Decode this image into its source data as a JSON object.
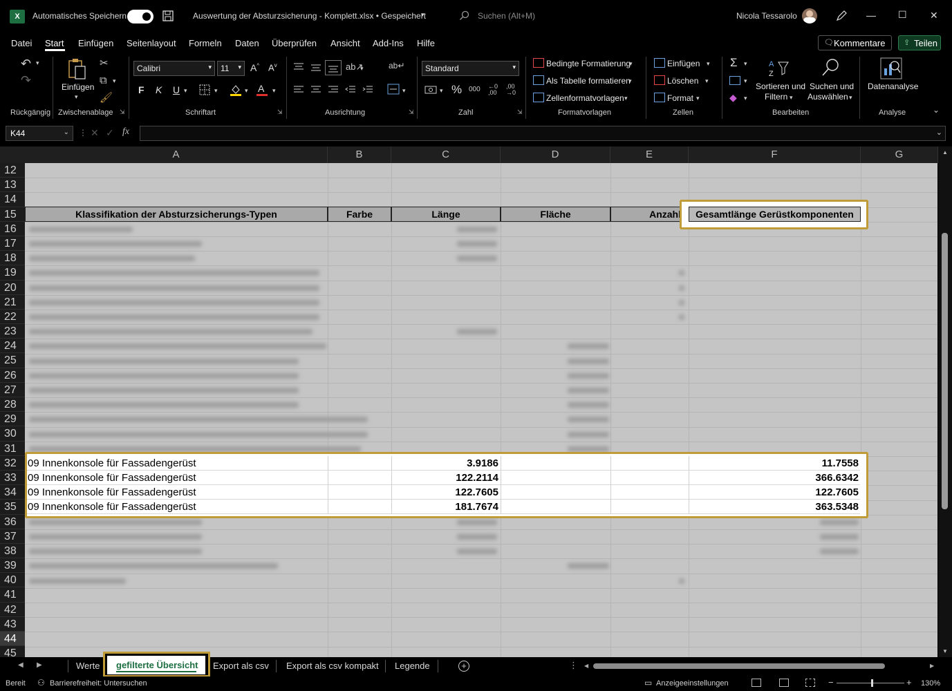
{
  "titlebar": {
    "app_badge": "X",
    "autosave_label": "Automatisches Speichern",
    "document_title": "Auswertung der Absturzsicherung - Komplett.xlsx • Gespeichert",
    "search_placeholder": "Suchen (Alt+M)",
    "user_name": "Nicola Tessarolo",
    "minimize": "—",
    "maximize": "☐",
    "close": "✕"
  },
  "menu": {
    "tabs": [
      "Datei",
      "Start",
      "Einfügen",
      "Seitenlayout",
      "Formeln",
      "Daten",
      "Überprüfen",
      "Ansicht",
      "Add-Ins",
      "Hilfe"
    ],
    "comments_label": "Kommentare",
    "share_label": "Teilen"
  },
  "ribbon": {
    "undo_group": "Rückgängig",
    "clipboard": {
      "paste_label": "Einfügen",
      "group": "Zwischenablage"
    },
    "font": {
      "name": "Calibri",
      "size": "11",
      "bold": "F",
      "italic": "K",
      "underline": "U",
      "group": "Schriftart"
    },
    "alignment": {
      "group": "Ausrichtung"
    },
    "number": {
      "format": "Standard",
      "percent": "%",
      "thousands": "000",
      "group": "Zahl"
    },
    "styles": {
      "conditional": "Bedingte Formatierung",
      "as_table": "Als Tabelle formatieren",
      "cell_styles": "Zellenformatvorlagen",
      "group": "Formatvorlagen"
    },
    "cells": {
      "insert": "Einfügen",
      "delete": "Löschen",
      "format": "Format",
      "group": "Zellen"
    },
    "editing": {
      "sort_filter_1": "Sortieren und",
      "sort_filter_2": "Filtern",
      "find_select_1": "Suchen und",
      "find_select_2": "Auswählen",
      "group": "Bearbeiten"
    },
    "analysis": {
      "label": "Datenanalyse",
      "group": "Analyse"
    }
  },
  "formula_bar": {
    "name_box": "K44",
    "fx": "fx",
    "value": ""
  },
  "columns": [
    "A",
    "B",
    "C",
    "D",
    "E",
    "F",
    "G"
  ],
  "row_numbers": [
    "12",
    "13",
    "14",
    "15",
    "16",
    "17",
    "18",
    "19",
    "20",
    "21",
    "22",
    "23",
    "24",
    "25",
    "26",
    "27",
    "28",
    "29",
    "30",
    "31",
    "32",
    "33",
    "34",
    "35",
    "36",
    "37",
    "38",
    "39",
    "40",
    "41",
    "42",
    "43",
    "44",
    "45"
  ],
  "table_header": {
    "classification": "Klassifikation der Absturzsicherungs-Typen",
    "color": "Farbe",
    "length": "Länge",
    "area": "Fläche",
    "count": "Anzahl",
    "total_length": "Gesamtlänge Gerüstkomponenten"
  },
  "highlighted_rows": [
    {
      "type": "09 Innenkonsole für Fassadengerüst",
      "length": "3.9186",
      "total": "11.7558"
    },
    {
      "type": "09 Innenkonsole für Fassadengerüst",
      "length": "122.2114",
      "total": "366.6342"
    },
    {
      "type": "09 Innenkonsole für Fassadengerüst",
      "length": "122.7605",
      "total": "122.7605"
    },
    {
      "type": "09 Innenkonsole für Fassadengerüst",
      "length": "181.7674",
      "total": "363.5348"
    }
  ],
  "sheet_tabs": [
    "Werte",
    "gefilterte Übersicht",
    "Export als csv",
    "Export als csv kompakt",
    "Legende"
  ],
  "active_sheet": "gefilterte Übersicht",
  "status": {
    "ready": "Bereit",
    "accessibility": "Barrierefreiheit: Untersuchen",
    "display_settings": "Anzeigeeinstellungen",
    "zoom": "130%"
  },
  "colors": {
    "highlight_border": "#bf9b3a",
    "excel_green": "#1d6f42",
    "sheet_dim": "#c5c5c5"
  }
}
